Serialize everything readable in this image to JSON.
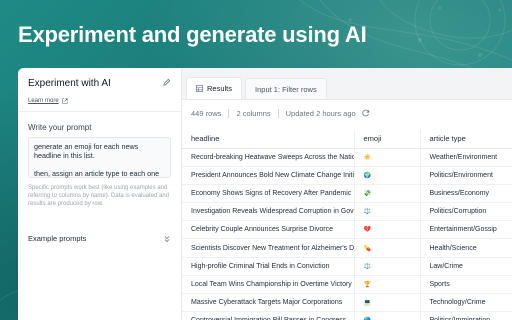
{
  "hero": {
    "title": "Experiment and generate using AI"
  },
  "left_panel": {
    "title": "Experiment with AI",
    "learn_more": "Learn more",
    "prompt_label": "Write your prompt",
    "prompt_line1": "generate an emoji for each news headline in this list.",
    "prompt_line2": "then, assign an article type to each one",
    "hint": "Specific prompts work best (like using examples and referring to columns by name). Data is evaluated and results are produced by row.",
    "example_prompts": "Example prompts"
  },
  "tabs": [
    {
      "label": "Results",
      "active": true
    },
    {
      "label": "Input 1: Filter rows",
      "active": false
    }
  ],
  "meta": {
    "rows": "449 rows",
    "columns": "2 columns",
    "updated": "Updated 2 hours ago"
  },
  "table": {
    "headers": [
      "headline",
      "emoji",
      "article type"
    ],
    "rows": [
      [
        "Record-breaking Heatwave Sweeps Across the Nation",
        "☀️",
        "Weather/Environment"
      ],
      [
        "President Announces Bold New Climate Change Initiative",
        "🌍",
        "Politics/Environment"
      ],
      [
        "Economy Shows Signs of Recovery After Pandemic",
        "💸",
        "Business/Economy"
      ],
      [
        "Investigation Reveals Widespread Corruption in Government",
        "⚖️",
        "Politics/Corruption"
      ],
      [
        "Celebrity Couple Announces Surprise Divorce",
        "💔",
        "Entertainment/Gossip"
      ],
      [
        "Scientists Discover New Treatment for Alzheimer's Disease",
        "💊",
        "Health/Science"
      ],
      [
        "High-profile Criminal Trial Ends in Conviction",
        "⚖️",
        "Law/Crime"
      ],
      [
        "Local Team Wins Championship in Overtime Victory",
        "🏆",
        "Sports"
      ],
      [
        "Massive Cyberattack Targets Major Corporations",
        "💻",
        "Technology/Crime"
      ],
      [
        "Controversial Immigration Bill Passes in Congress",
        "🌎",
        "Politics/Immigration"
      ]
    ]
  }
}
